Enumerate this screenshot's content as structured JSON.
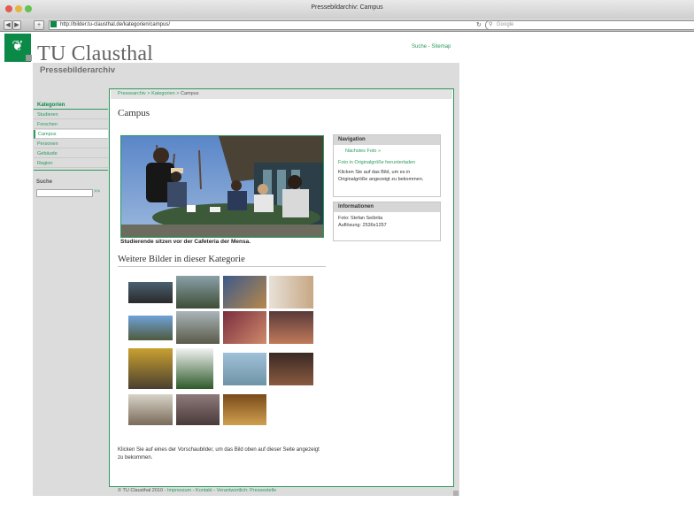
{
  "browser": {
    "window_title": "Pressebildarchiv: Campus",
    "url": "http://bilder.tu-clausthal.de/kategorien/campus/",
    "search_placeholder": "Google",
    "back_label": "◀",
    "forward_label": "▶",
    "add_label": "+",
    "reload_icon": "↻"
  },
  "site": {
    "logo_glyph": "❦",
    "brand": "TU Clausthal",
    "subtitle": "Pressebilderarchiv",
    "utility_links": [
      "Suche",
      "Sitemap"
    ],
    "utility_separator": " - "
  },
  "breadcrumb": {
    "items": [
      "Pressearchiv",
      "Kategorien",
      "Campus"
    ],
    "separator": " > "
  },
  "sidebar": {
    "heading": "Kategorien",
    "items": [
      {
        "label": "Studieren",
        "active": false
      },
      {
        "label": "Forschen",
        "active": false
      },
      {
        "label": "Campus",
        "active": true
      },
      {
        "label": "Personen",
        "active": false
      },
      {
        "label": "Gebäude",
        "active": false
      },
      {
        "label": "Region",
        "active": false
      }
    ],
    "search_label": "Suche",
    "search_go": ">>"
  },
  "main": {
    "title": "Campus",
    "caption": "Studierende sitzen vor der Cafeteria der Mensa.",
    "more_title": "Weitere Bilder in dieser Kategorie",
    "help_text": "Klicken Sie auf eines der Vorschaubilder, um das Bild oben auf dieser Seite angezeigt zu bekommen."
  },
  "navigation_box": {
    "heading": "Navigation",
    "next": "Nächstes Foto »",
    "download": "Foto in Originalgröße herunterladen",
    "hint": "Klicken Sie auf das Bild, um es in Originalgröße angezeigt zu bekommen."
  },
  "info_box": {
    "heading": "Informationen",
    "photo": "Foto: Stefan Seibrita",
    "resolution": "Auflösung: 2536x1257"
  },
  "footer": {
    "copyright": "© TU Clausthal 2010",
    "links": [
      "Impressum",
      "Kontakt",
      "Verantwortlich: Pressestelle"
    ],
    "separator": " - "
  },
  "colors": {
    "accent": "#2a9a5d",
    "brand_green": "#0b8a47",
    "panel_gray": "#dcdcdc",
    "close_light": "#e25b52",
    "min_light": "#e4b640",
    "zoom_light": "#62c14f"
  }
}
